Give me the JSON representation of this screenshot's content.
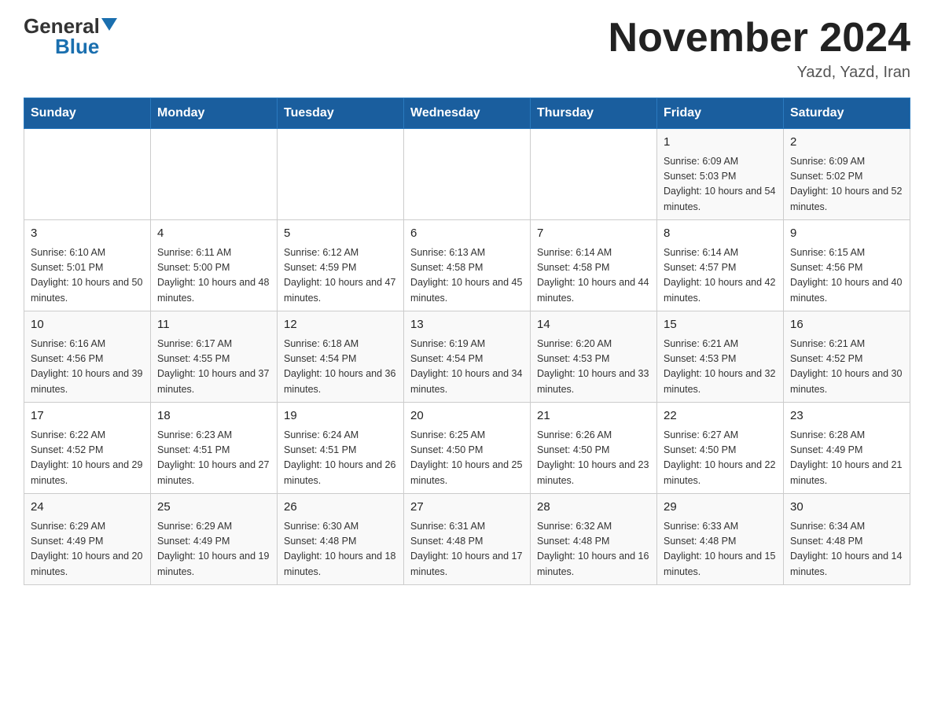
{
  "header": {
    "logo_general": "General",
    "logo_blue": "Blue",
    "title": "November 2024",
    "subtitle": "Yazd, Yazd, Iran"
  },
  "weekdays": [
    "Sunday",
    "Monday",
    "Tuesday",
    "Wednesday",
    "Thursday",
    "Friday",
    "Saturday"
  ],
  "weeks": [
    [
      {
        "day": "",
        "info": ""
      },
      {
        "day": "",
        "info": ""
      },
      {
        "day": "",
        "info": ""
      },
      {
        "day": "",
        "info": ""
      },
      {
        "day": "",
        "info": ""
      },
      {
        "day": "1",
        "info": "Sunrise: 6:09 AM\nSunset: 5:03 PM\nDaylight: 10 hours and 54 minutes."
      },
      {
        "day": "2",
        "info": "Sunrise: 6:09 AM\nSunset: 5:02 PM\nDaylight: 10 hours and 52 minutes."
      }
    ],
    [
      {
        "day": "3",
        "info": "Sunrise: 6:10 AM\nSunset: 5:01 PM\nDaylight: 10 hours and 50 minutes."
      },
      {
        "day": "4",
        "info": "Sunrise: 6:11 AM\nSunset: 5:00 PM\nDaylight: 10 hours and 48 minutes."
      },
      {
        "day": "5",
        "info": "Sunrise: 6:12 AM\nSunset: 4:59 PM\nDaylight: 10 hours and 47 minutes."
      },
      {
        "day": "6",
        "info": "Sunrise: 6:13 AM\nSunset: 4:58 PM\nDaylight: 10 hours and 45 minutes."
      },
      {
        "day": "7",
        "info": "Sunrise: 6:14 AM\nSunset: 4:58 PM\nDaylight: 10 hours and 44 minutes."
      },
      {
        "day": "8",
        "info": "Sunrise: 6:14 AM\nSunset: 4:57 PM\nDaylight: 10 hours and 42 minutes."
      },
      {
        "day": "9",
        "info": "Sunrise: 6:15 AM\nSunset: 4:56 PM\nDaylight: 10 hours and 40 minutes."
      }
    ],
    [
      {
        "day": "10",
        "info": "Sunrise: 6:16 AM\nSunset: 4:56 PM\nDaylight: 10 hours and 39 minutes."
      },
      {
        "day": "11",
        "info": "Sunrise: 6:17 AM\nSunset: 4:55 PM\nDaylight: 10 hours and 37 minutes."
      },
      {
        "day": "12",
        "info": "Sunrise: 6:18 AM\nSunset: 4:54 PM\nDaylight: 10 hours and 36 minutes."
      },
      {
        "day": "13",
        "info": "Sunrise: 6:19 AM\nSunset: 4:54 PM\nDaylight: 10 hours and 34 minutes."
      },
      {
        "day": "14",
        "info": "Sunrise: 6:20 AM\nSunset: 4:53 PM\nDaylight: 10 hours and 33 minutes."
      },
      {
        "day": "15",
        "info": "Sunrise: 6:21 AM\nSunset: 4:53 PM\nDaylight: 10 hours and 32 minutes."
      },
      {
        "day": "16",
        "info": "Sunrise: 6:21 AM\nSunset: 4:52 PM\nDaylight: 10 hours and 30 minutes."
      }
    ],
    [
      {
        "day": "17",
        "info": "Sunrise: 6:22 AM\nSunset: 4:52 PM\nDaylight: 10 hours and 29 minutes."
      },
      {
        "day": "18",
        "info": "Sunrise: 6:23 AM\nSunset: 4:51 PM\nDaylight: 10 hours and 27 minutes."
      },
      {
        "day": "19",
        "info": "Sunrise: 6:24 AM\nSunset: 4:51 PM\nDaylight: 10 hours and 26 minutes."
      },
      {
        "day": "20",
        "info": "Sunrise: 6:25 AM\nSunset: 4:50 PM\nDaylight: 10 hours and 25 minutes."
      },
      {
        "day": "21",
        "info": "Sunrise: 6:26 AM\nSunset: 4:50 PM\nDaylight: 10 hours and 23 minutes."
      },
      {
        "day": "22",
        "info": "Sunrise: 6:27 AM\nSunset: 4:50 PM\nDaylight: 10 hours and 22 minutes."
      },
      {
        "day": "23",
        "info": "Sunrise: 6:28 AM\nSunset: 4:49 PM\nDaylight: 10 hours and 21 minutes."
      }
    ],
    [
      {
        "day": "24",
        "info": "Sunrise: 6:29 AM\nSunset: 4:49 PM\nDaylight: 10 hours and 20 minutes."
      },
      {
        "day": "25",
        "info": "Sunrise: 6:29 AM\nSunset: 4:49 PM\nDaylight: 10 hours and 19 minutes."
      },
      {
        "day": "26",
        "info": "Sunrise: 6:30 AM\nSunset: 4:48 PM\nDaylight: 10 hours and 18 minutes."
      },
      {
        "day": "27",
        "info": "Sunrise: 6:31 AM\nSunset: 4:48 PM\nDaylight: 10 hours and 17 minutes."
      },
      {
        "day": "28",
        "info": "Sunrise: 6:32 AM\nSunset: 4:48 PM\nDaylight: 10 hours and 16 minutes."
      },
      {
        "day": "29",
        "info": "Sunrise: 6:33 AM\nSunset: 4:48 PM\nDaylight: 10 hours and 15 minutes."
      },
      {
        "day": "30",
        "info": "Sunrise: 6:34 AM\nSunset: 4:48 PM\nDaylight: 10 hours and 14 minutes."
      }
    ]
  ]
}
